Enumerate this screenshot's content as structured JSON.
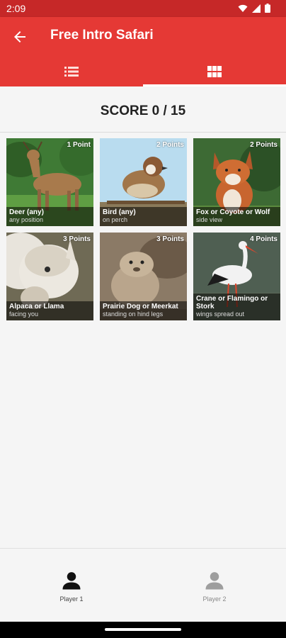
{
  "status_bar": {
    "time": "2:09",
    "icons": [
      "wifi-icon",
      "cell-signal-icon",
      "battery-icon"
    ]
  },
  "app_bar": {
    "title": "Free Intro Safari",
    "back_icon": "back-arrow-icon",
    "tabs": [
      {
        "icon": "list-icon",
        "selected": false
      },
      {
        "icon": "grid-icon",
        "selected": true
      }
    ]
  },
  "score": {
    "text": "SCORE 0 / 15"
  },
  "cards": [
    {
      "points": "1 Point",
      "name": "Deer (any)",
      "detail": "any position"
    },
    {
      "points": "2 Points",
      "name": "Bird (any)",
      "detail": "on perch"
    },
    {
      "points": "2 Points",
      "name": "Fox or Coyote or Wolf",
      "detail": "side view"
    },
    {
      "points": "3 Points",
      "name": "Alpaca or Llama",
      "detail": "facing you"
    },
    {
      "points": "3 Points",
      "name": "Prairie Dog or Meerkat",
      "detail": "standing on hind legs"
    },
    {
      "points": "4 Points",
      "name": "Crane or Flamingo or Stork",
      "detail": "wings spread out"
    }
  ],
  "players": [
    {
      "label": "Player 1",
      "active": true
    },
    {
      "label": "Player 2",
      "active": false
    }
  ],
  "colors": {
    "status_bar": "#c62828",
    "app_bar": "#e53935",
    "player_active": "#111111",
    "player_inactive": "#9e9e9e"
  }
}
